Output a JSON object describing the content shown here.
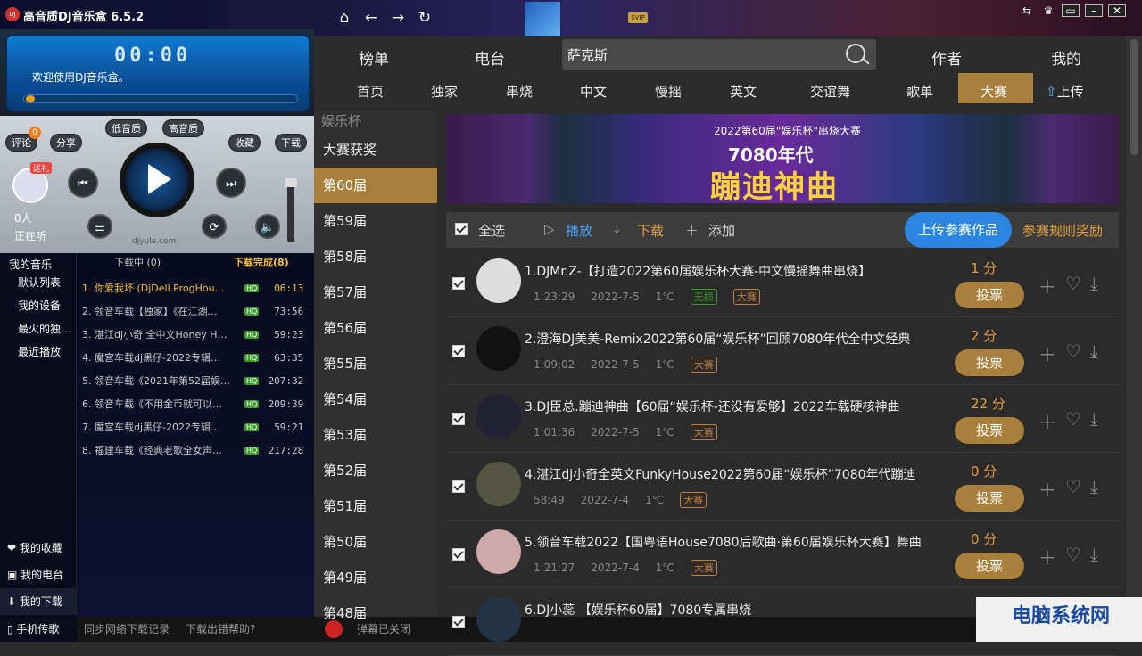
{
  "app": {
    "title": "高音质DJ音乐盒 6.5.2",
    "logo": "DJ"
  },
  "titlebar": {
    "svip": "SVIP"
  },
  "player": {
    "time": "00:00",
    "welcome": "欢迎使用DJ音乐盒。",
    "comment": "评论",
    "comment_count": "0",
    "share": "分享",
    "low_quality": "低音质",
    "high_quality": "高音质",
    "collect": "收藏",
    "download": "下载",
    "gift": "送礼",
    "listeners": "0人",
    "listening": "正在听",
    "watermark": "djyule.com"
  },
  "left_cats": [
    "我的音乐",
    "默认列表",
    "我的设备",
    "最火的独…",
    "最近播放"
  ],
  "left_bottom": [
    "我的收藏",
    "我的电台",
    "我的下载",
    "手机传歌"
  ],
  "downloads": {
    "downloading": "下载中 (0)",
    "done": "下载完成(8)",
    "items": [
      {
        "t": "1. 你爱我坏 (DjDell ProgHou…",
        "d": "06:13"
      },
      {
        "t": "2. 领音车载【独家】《在江湖…",
        "d": "73:56"
      },
      {
        "t": "3. 湛江dj小奇 全中文Honey H…",
        "d": "59:23"
      },
      {
        "t": "4. 魔宫车载dj黑仔-2022专辑…",
        "d": "63:35"
      },
      {
        "t": "5. 领音车载《2021年第52届娱…",
        "d": "207:32"
      },
      {
        "t": "6. 领音车载《不用金币就可以…",
        "d": "209:39"
      },
      {
        "t": "7. 魔宫车载dj黑仔-2022专辑…",
        "d": "59:21"
      },
      {
        "t": "8. 福建车载《经典老歌全女声…",
        "d": "217:28"
      }
    ],
    "hq": "HQ"
  },
  "footer": {
    "sync": "同步网络下载记录",
    "help": "下载出错帮助?",
    "danmu": "弹幕已关闭"
  },
  "topnav": {
    "charts": "榜单",
    "radio": "电台",
    "search_value": "萨克斯",
    "author": "作者",
    "mine": "我的"
  },
  "subnav": [
    "首页",
    "独家",
    "串烧",
    "中文",
    "慢摇",
    "英文",
    "交谊舞",
    "歌单",
    "大赛"
  ],
  "upload": "上传",
  "sidebar": {
    "title": "娱乐杯",
    "items": [
      "大赛获奖",
      "第60届",
      "第59届",
      "第58届",
      "第57届",
      "第56届",
      "第55届",
      "第54届",
      "第53届",
      "第52届",
      "第51届",
      "第50届",
      "第49届",
      "第48届"
    ]
  },
  "banner": {
    "small": "2022第60届\"娱乐杯\"串烧大赛",
    "mid": "7080年代",
    "big": "蹦迪神曲"
  },
  "toolbar": {
    "select_all": "全选",
    "play": "播放",
    "download": "下载",
    "add": "添加",
    "upload_entry": "上传参赛作品",
    "rules": "参赛规则奖励"
  },
  "songs": [
    {
      "title": "1.DJMr.Z-【打造2022第60届娱乐杯大赛-中文慢摇舞曲串烧】",
      "dur": "1:23:29",
      "date": "2022-7-5",
      "temp": "1℃",
      "tags": [
        "无损",
        "大赛"
      ],
      "score": "1 分"
    },
    {
      "title": "2.澄海DJ美美-Remix2022第60届“娱乐杯”回顾7080年代全中文经典",
      "dur": "1:09:02",
      "date": "2022-7-5",
      "temp": "1℃",
      "tags": [
        "大赛"
      ],
      "score": "2 分"
    },
    {
      "title": "3.DJ臣总.蹦迪神曲【60届“娱乐杯-还没有爱够】2022车载硬核神曲",
      "dur": "1:01:36",
      "date": "2022-7-5",
      "temp": "1℃",
      "tags": [
        "大赛"
      ],
      "score": "22 分"
    },
    {
      "title": "4.湛江dj小奇全英文FunkyHouse2022第60届“娱乐杯”7080年代蹦迪",
      "dur": "58:49",
      "date": "2022-7-4",
      "temp": "1℃",
      "tags": [
        "大赛"
      ],
      "score": "0 分"
    },
    {
      "title": "5.领音车载2022【国粤语House7080后歌曲·第60届娱乐杯大赛】舞曲",
      "dur": "1:21:27",
      "date": "2022-7-4",
      "temp": "1℃",
      "tags": [
        "大赛"
      ],
      "score": "0 分"
    },
    {
      "title": "6.DJ小蕊 【娱乐杯60届】7080专属串烧",
      "dur": "",
      "date": "",
      "temp": "",
      "tags": [],
      "score": ""
    }
  ],
  "vote": "投票",
  "watermark": "电脑系统网"
}
